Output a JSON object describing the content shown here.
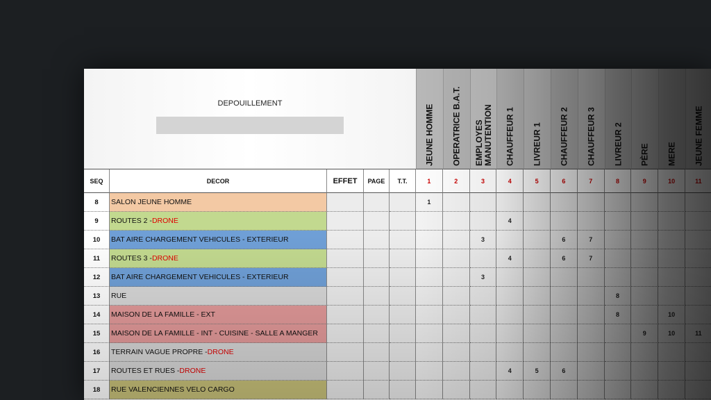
{
  "sheet": {
    "title": "DEPOUILLEMENT",
    "headers": {
      "seq": "SEQ",
      "decor": "DECOR",
      "effet": "EFFET",
      "page": "PAGE",
      "tt": "T.T."
    }
  },
  "characters": [
    {
      "num": "1",
      "name": "JEUNE HOMME",
      "bg": "#b9b9b9"
    },
    {
      "num": "2",
      "name": "OPERATRICE B.A.T.",
      "bg": "#b3b3b3"
    },
    {
      "num": "3",
      "name": "EMPLOYES MANUTENTION",
      "bg": "#bcbcbc"
    },
    {
      "num": "4",
      "name": "CHAUFFEUR 1",
      "bg": "#b0b0b0"
    },
    {
      "num": "5",
      "name": "LIVREUR 1",
      "bg": "#b7b7b7"
    },
    {
      "num": "6",
      "name": "CHAUFFEUR 2",
      "bg": "#adadad"
    },
    {
      "num": "7",
      "name": "CHAUFFEUR 3",
      "bg": "#b5b5b5"
    },
    {
      "num": "8",
      "name": "LIVREUR 2",
      "bg": "#ababab"
    },
    {
      "num": "9",
      "name": "PÈRE",
      "bg": "#b1b1b1"
    },
    {
      "num": "10",
      "name": "MERE",
      "bg": "#a9a9a9"
    },
    {
      "num": "11",
      "name": "JEUNE FEMME",
      "bg": "#b0b0b0"
    }
  ],
  "rows": [
    {
      "seq": "8",
      "decor": "SALON JEUNE HOMME",
      "suffix": "",
      "color": "#f3c9a4",
      "marks": [
        "1",
        "",
        "",
        "",
        "",
        "",
        "",
        "",
        "",
        "",
        ""
      ]
    },
    {
      "seq": "9",
      "decor": "ROUTES 2 - ",
      "suffix": "DRONE",
      "color": "#c2d98f",
      "marks": [
        "",
        "",
        "",
        "4",
        "",
        "",
        "",
        "",
        "",
        "",
        ""
      ]
    },
    {
      "seq": "10",
      "decor": "BAT AIRE CHARGEMENT VEHICULES - EXTERIEUR",
      "suffix": "",
      "color": "#6f9fd6",
      "marks": [
        "",
        "",
        "3",
        "",
        "",
        "6",
        "7",
        "",
        "",
        "",
        ""
      ]
    },
    {
      "seq": "11",
      "decor": "ROUTES 3 - ",
      "suffix": "DRONE",
      "color": "#c2d98f",
      "marks": [
        "",
        "",
        "",
        "4",
        "",
        "6",
        "7",
        "",
        "",
        "",
        ""
      ]
    },
    {
      "seq": "12",
      "decor": "BAT AIRE CHARGEMENT VEHICULES - EXTERIEUR",
      "suffix": "",
      "color": "#6f9fd6",
      "marks": [
        "",
        "",
        "3",
        "",
        "",
        "",
        "",
        "",
        "",
        "",
        ""
      ]
    },
    {
      "seq": "13",
      "decor": "RUE",
      "suffix": "",
      "color": "#d8d8d8",
      "marks": [
        "",
        "",
        "",
        "",
        "",
        "",
        "",
        "8",
        "",
        "",
        ""
      ]
    },
    {
      "seq": "14",
      "decor": "MAISON DE LA FAMILLE - EXT",
      "suffix": "",
      "color": "#e39a9a",
      "marks": [
        "",
        "",
        "",
        "",
        "",
        "",
        "",
        "8",
        "",
        "10",
        ""
      ]
    },
    {
      "seq": "15",
      "decor": "MAISON DE LA FAMILLE - INT - CUISINE - SALLE A MANGER",
      "suffix": "",
      "color": "#e39a9a",
      "marks": [
        "",
        "",
        "",
        "",
        "",
        "",
        "",
        "",
        "9",
        "10",
        "11"
      ]
    },
    {
      "seq": "16",
      "decor": "TERRAIN VAGUE PROPRE - ",
      "suffix": "DRONE",
      "color": "#d8d8d8",
      "marks": [
        "",
        "",
        "",
        "",
        "",
        "",
        "",
        "",
        "",
        "",
        ""
      ]
    },
    {
      "seq": "17",
      "decor": "ROUTES ET RUES - ",
      "suffix": "DRONE",
      "color": "#d8d8d8",
      "marks": [
        "",
        "",
        "",
        "4",
        "5",
        "6",
        "",
        "",
        "",
        "",
        ""
      ]
    },
    {
      "seq": "18",
      "decor": "RUE VALENCIENNES VELO CARGO",
      "suffix": "",
      "color": "#c9c27a",
      "marks": [
        "",
        "",
        "",
        "",
        "",
        "",
        "",
        "",
        "",
        "",
        ""
      ]
    }
  ]
}
